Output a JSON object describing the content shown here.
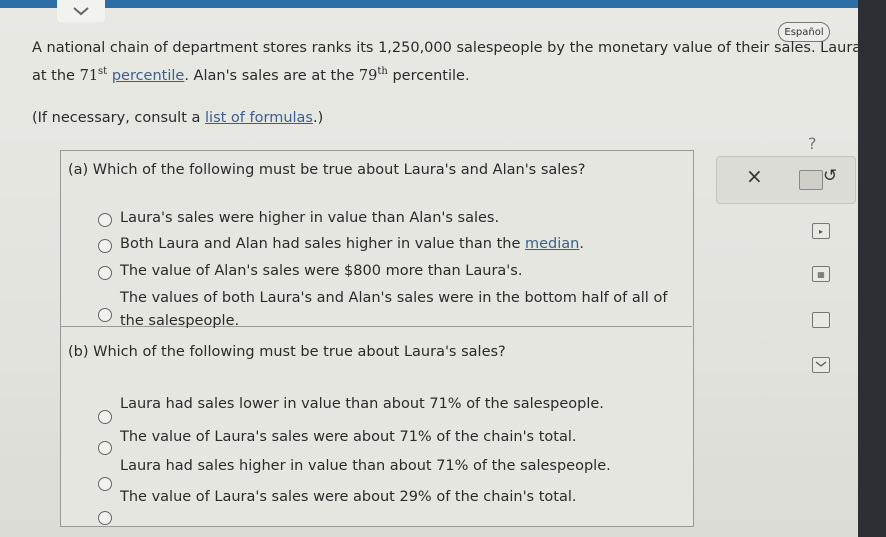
{
  "header": {
    "language_label": "Español"
  },
  "problem": {
    "line1": "A national chain of department stores ranks its 1,250,000 salespeople by the monetary value of their sales. Laura's",
    "line2_prefix": "at the",
    "laura_pct": "71",
    "laura_pct_suffix": "st",
    "percentile_link": "percentile",
    "line2_mid": ". Alan's sales are at the",
    "alan_pct": "79",
    "alan_pct_suffix": "th",
    "line2_end": "percentile.",
    "consult_prefix": "(If necessary, consult a",
    "consult_link": "list of formulas",
    "consult_suffix": ".)"
  },
  "part_a": {
    "question": "(a) Which of the following must be true about Laura's and Alan's sales?",
    "options": [
      "Laura's sales were higher in value than Alan's sales.",
      "Both Laura and Alan had sales higher in value than the",
      "The value of Alan's sales were $800 more than Laura's.",
      "The values of both Laura's and Alan's sales were in the bottom half of all of",
      "the salespeople."
    ],
    "median_link": "median",
    "option2_end": "."
  },
  "part_b": {
    "question": "(b) Which of the following must be true about Laura's sales?",
    "options": [
      "Laura had sales lower in value than about 71% of the salespeople.",
      "The value of Laura's sales were about 71% of the chain's total.",
      "Laura had sales higher in value than about 71% of the salespeople.",
      "The value of Laura's sales were about 29% of the chain's total."
    ]
  },
  "tools": {
    "close_symbol": "×",
    "undo_symbol": "↺",
    "help_symbol": "?"
  },
  "icons": {
    "chevron": "chevron-down-icon",
    "calculator": "calculator-icon",
    "play": "play-icon",
    "data_table": "data-table-icon",
    "text": "text-icon",
    "mail": "mail-icon"
  }
}
